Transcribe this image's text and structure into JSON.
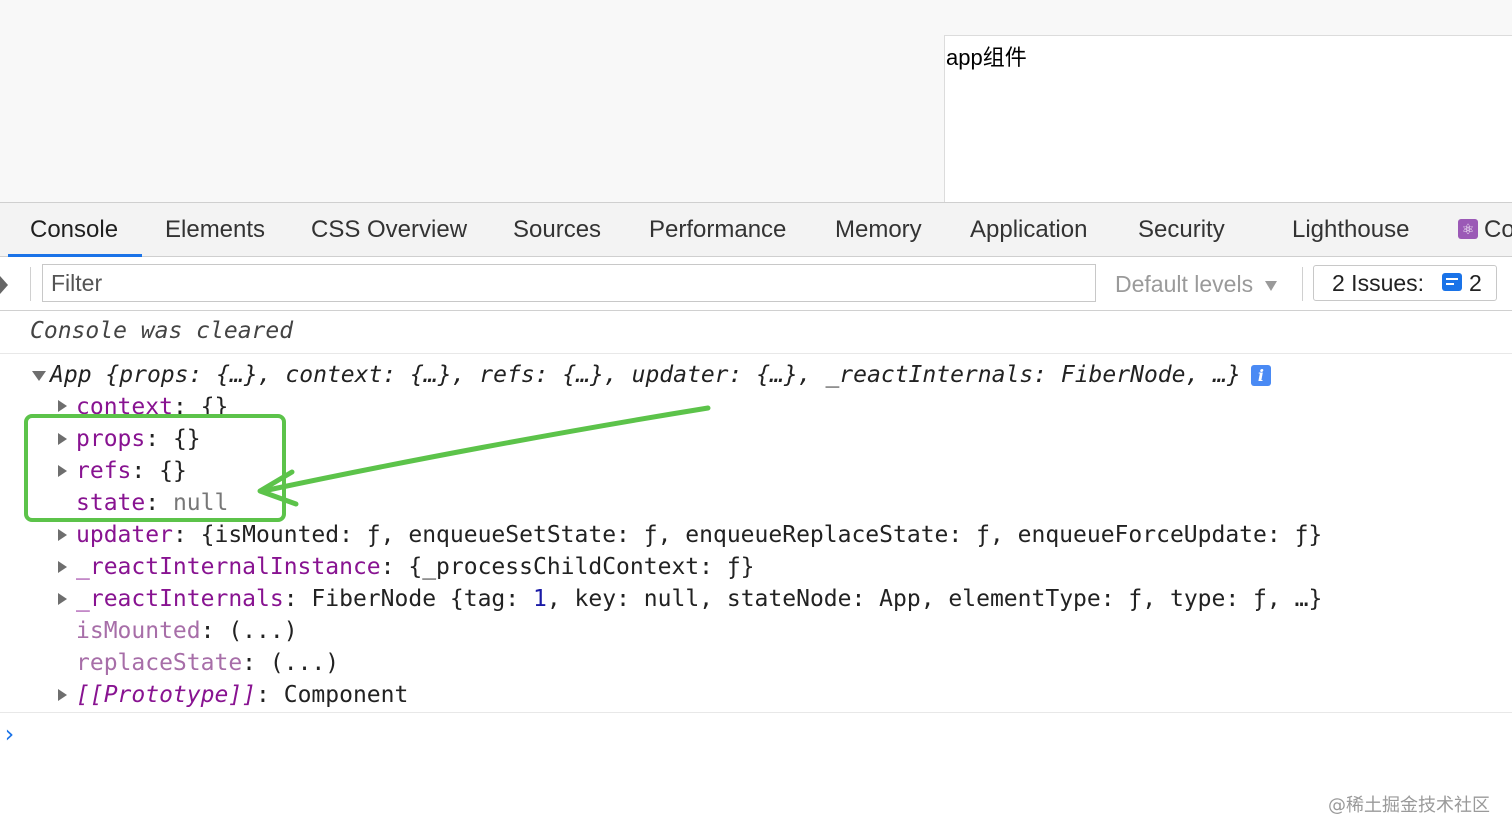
{
  "page": {
    "app_text": "app组件"
  },
  "devtools": {
    "tabs": [
      {
        "label": "Console",
        "active": true
      },
      {
        "label": "Elements"
      },
      {
        "label": "CSS Overview"
      },
      {
        "label": "Sources"
      },
      {
        "label": "Performance"
      },
      {
        "label": "Memory"
      },
      {
        "label": "Application"
      },
      {
        "label": "Security"
      },
      {
        "label": "Lighthouse"
      },
      {
        "label": "Co",
        "icon": "react-icon"
      }
    ],
    "filter": {
      "placeholder": "Filter",
      "levels": "Default levels",
      "issues_label": "2 Issues:",
      "issues_count": "2",
      "icons": [
        "sidebar-toggle-icon",
        "dropdown-arrow-icon",
        "issues-icon"
      ]
    },
    "console": {
      "cleared": "Console was cleared",
      "app": {
        "name": "App",
        "summary": "{props: {…}, context: {…}, refs: {…}, updater: {…}, _reactInternals: FiberNode, …}",
        "info_icon": "i"
      },
      "props": {
        "context": {
          "key": "context",
          "value": "{}"
        },
        "props": {
          "key": "props",
          "value": "{}"
        },
        "refs": {
          "key": "refs",
          "value": "{}"
        },
        "state": {
          "key": "state",
          "value": "null"
        },
        "updater": {
          "key": "updater",
          "value": "{isMounted: ƒ, enqueueSetState: ƒ, enqueueReplaceState: ƒ, enqueueForceUpdate: ƒ}"
        },
        "reactInternalInstance": {
          "key": "_reactInternalInstance",
          "value": "{_processChildContext: ƒ}"
        },
        "reactInternals": {
          "key": "_reactInternals",
          "value_a": "FiberNode {tag: ",
          "value_num": "1",
          "value_b": ", key: null, stateNode: App, elementType: ƒ, type: ƒ, …}"
        },
        "isMounted": {
          "key": "isMounted",
          "value": "(...)"
        },
        "replaceState": {
          "key": "replaceState",
          "value": "(...)"
        },
        "prototype": {
          "key": "[[Prototype]]",
          "value": "Component"
        }
      },
      "separator": ": ",
      "prompt": "›"
    }
  },
  "annotation": {
    "color": "#5cc34a"
  },
  "watermark": "@稀土掘金技术社区"
}
